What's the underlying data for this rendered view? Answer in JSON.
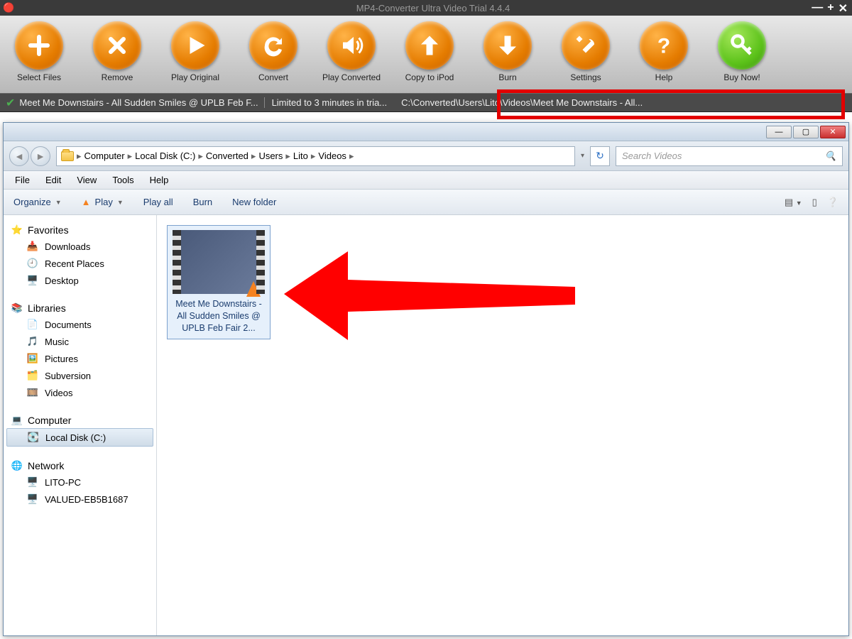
{
  "app": {
    "title": "MP4-Converter Ultra Video Trial 4.4.4",
    "toolbar": [
      {
        "label": "Select Files",
        "icon": "plus"
      },
      {
        "label": "Remove",
        "icon": "x"
      },
      {
        "label": "Play Original",
        "icon": "play"
      },
      {
        "label": "Convert",
        "icon": "refresh"
      },
      {
        "label": "Play Converted",
        "icon": "sound"
      },
      {
        "label": "Copy to iPod",
        "icon": "up"
      },
      {
        "label": "Burn",
        "icon": "down"
      },
      {
        "label": "Settings",
        "icon": "tools"
      },
      {
        "label": "Help",
        "icon": "question"
      },
      {
        "label": "Buy Now!",
        "icon": "key",
        "green": true
      }
    ],
    "status": {
      "file": "Meet Me Downstairs - All Sudden Smiles @ UPLB Feb F...",
      "limit": "Limited to 3 minutes in tria...",
      "path": "C:\\Converted\\Users\\Lito\\Videos\\Meet Me Downstairs - All..."
    }
  },
  "explorer": {
    "breadcrumbs": [
      "Computer",
      "Local Disk (C:)",
      "Converted",
      "Users",
      "Lito",
      "Videos"
    ],
    "search_placeholder": "Search Videos",
    "menu": [
      "File",
      "Edit",
      "View",
      "Tools",
      "Help"
    ],
    "cmd": {
      "organize": "Organize",
      "play": "Play",
      "play_all": "Play all",
      "burn": "Burn",
      "new_folder": "New folder"
    },
    "nav": {
      "favorites": {
        "label": "Favorites",
        "items": [
          "Downloads",
          "Recent Places",
          "Desktop"
        ]
      },
      "libraries": {
        "label": "Libraries",
        "items": [
          "Documents",
          "Music",
          "Pictures",
          "Subversion",
          "Videos"
        ]
      },
      "computer": {
        "label": "Computer",
        "items": [
          "Local Disk (C:)"
        ]
      },
      "network": {
        "label": "Network",
        "items": [
          "LITO-PC",
          "VALUED-EB5B1687"
        ]
      }
    },
    "file": {
      "name": "Meet Me Downstairs - All Sudden Smiles @ UPLB Feb Fair 2..."
    }
  }
}
